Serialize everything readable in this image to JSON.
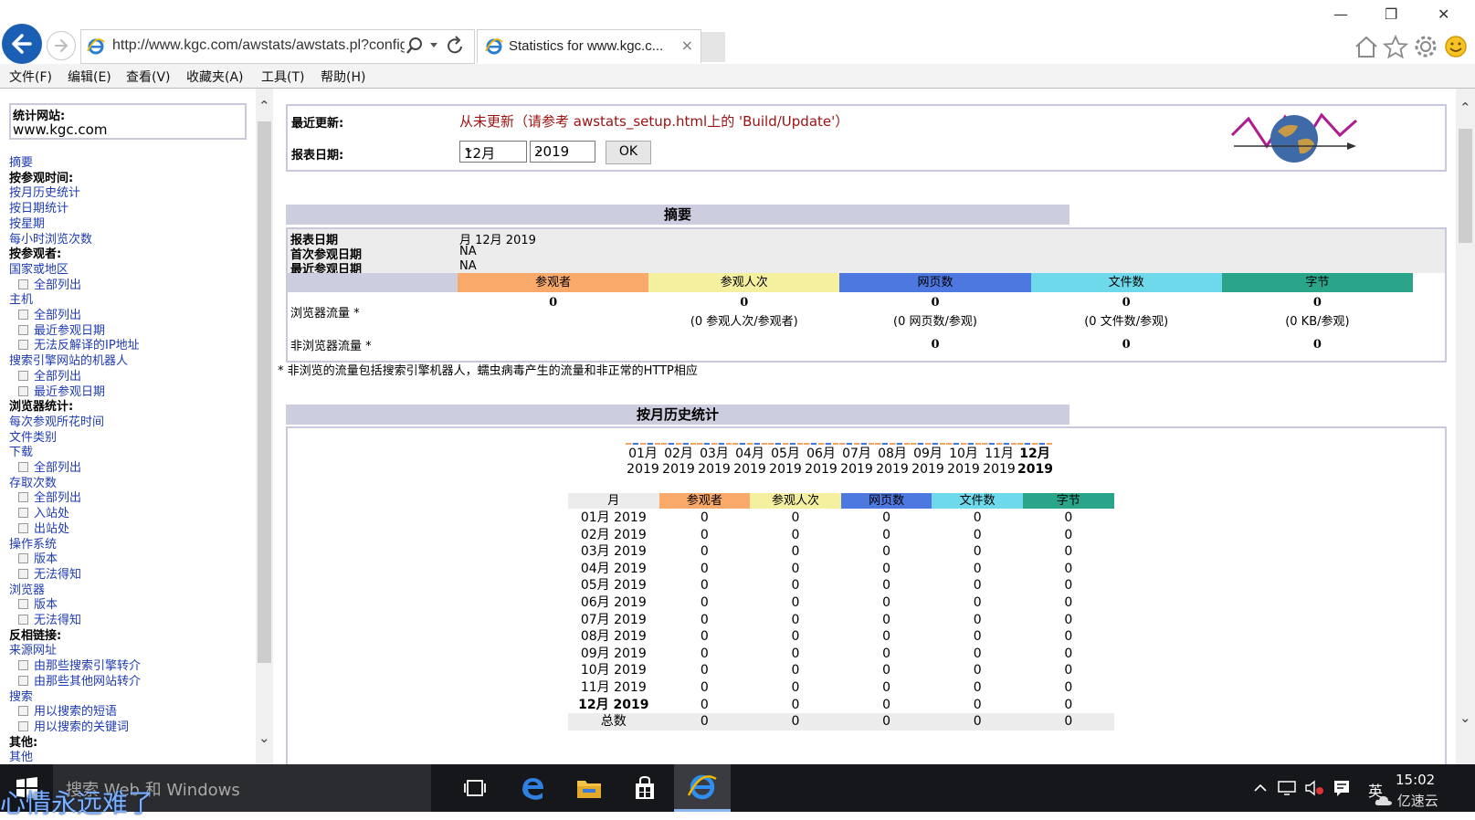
{
  "browser": {
    "url": "http://www.kgc.com/awstats/awstats.pl?config=www.kgc.com",
    "tab_title": "Statistics for www.kgc.c...",
    "tab_close": "×",
    "menu": [
      "文件(F)",
      "编辑(E)",
      "查看(V)",
      "收藏夹(A)",
      "工具(T)",
      "帮助(H)"
    ]
  },
  "sidebar": {
    "site_label": "统计网站:",
    "site_value": "www.kgc.com",
    "items": [
      {
        "text": "摘要",
        "kind": "link"
      },
      {
        "text": "按参观时间:",
        "kind": "heading"
      },
      {
        "text": "按月历史统计",
        "kind": "link"
      },
      {
        "text": "按日期统计",
        "kind": "link"
      },
      {
        "text": "按星期",
        "kind": "link"
      },
      {
        "text": "每小时浏览次数",
        "kind": "link"
      },
      {
        "text": "按参观者:",
        "kind": "heading"
      },
      {
        "text": "国家或地区",
        "kind": "link"
      },
      {
        "text": "全部列出",
        "kind": "sub"
      },
      {
        "text": "主机",
        "kind": "link"
      },
      {
        "text": "全部列出",
        "kind": "sub"
      },
      {
        "text": "最近参观日期",
        "kind": "sub"
      },
      {
        "text": "无法反解译的IP地址",
        "kind": "sub"
      },
      {
        "text": "搜索引擎网站的机器人",
        "kind": "link"
      },
      {
        "text": "全部列出",
        "kind": "sub"
      },
      {
        "text": "最近参观日期",
        "kind": "sub"
      },
      {
        "text": "浏览器统计:",
        "kind": "heading"
      },
      {
        "text": "每次参观所花时间",
        "kind": "link"
      },
      {
        "text": "文件类别",
        "kind": "link"
      },
      {
        "text": "下载",
        "kind": "link"
      },
      {
        "text": "全部列出",
        "kind": "sub"
      },
      {
        "text": "存取次数",
        "kind": "link"
      },
      {
        "text": "全部列出",
        "kind": "sub"
      },
      {
        "text": "入站处",
        "kind": "sub"
      },
      {
        "text": "出站处",
        "kind": "sub"
      },
      {
        "text": "操作系统",
        "kind": "link"
      },
      {
        "text": "版本",
        "kind": "sub"
      },
      {
        "text": "无法得知",
        "kind": "sub"
      },
      {
        "text": "浏览器",
        "kind": "link"
      },
      {
        "text": "版本",
        "kind": "sub"
      },
      {
        "text": "无法得知",
        "kind": "sub"
      },
      {
        "text": "反相链接:",
        "kind": "heading"
      },
      {
        "text": "来源网址",
        "kind": "link"
      },
      {
        "text": "由那些搜索引擎转介",
        "kind": "sub"
      },
      {
        "text": "由那些其他网站转介",
        "kind": "sub"
      },
      {
        "text": "搜索",
        "kind": "link"
      },
      {
        "text": "用以搜索的短语",
        "kind": "sub"
      },
      {
        "text": "用以搜索的关键词",
        "kind": "sub"
      },
      {
        "text": "其他:",
        "kind": "heading"
      },
      {
        "text": "其他",
        "kind": "link"
      }
    ]
  },
  "update": {
    "last_update_label": "最近更新:",
    "last_update_value": "从未更新（请参考 awstats_setup.html上的 'Build/Update'）",
    "report_date_label": "报表日期:",
    "month_select": "12月",
    "year_select": "2019",
    "ok_label": "OK"
  },
  "summary": {
    "title": "摘要",
    "rows": [
      {
        "label": "报表日期",
        "value": "月 12月 2019"
      },
      {
        "label": "首次参观日期",
        "value": "NA"
      },
      {
        "label": "最近参观日期",
        "value": "NA"
      }
    ],
    "columns": [
      {
        "label": "参观者",
        "color": "#f9a96a"
      },
      {
        "label": "参观人次",
        "color": "#f4f0a0"
      },
      {
        "label": "网页数",
        "color": "#4d78e0"
      },
      {
        "label": "文件数",
        "color": "#6fd9ec"
      },
      {
        "label": "字节",
        "color": "#2aa58a"
      }
    ],
    "browser_label": "浏览器流量 *",
    "browser_values": [
      "0",
      "0",
      "0",
      "0",
      "0"
    ],
    "browser_sub": [
      "",
      "(0 参观人次/参观者)",
      "(0 网页数/参观)",
      "(0 文件数/参观)",
      "(0 KB/参观)"
    ],
    "nonbrowser_label": "非浏览器流量 *",
    "nonbrowser_values": [
      "0",
      "0",
      "0"
    ],
    "footnote": "* 非浏览的流量包括搜索引擎机器人，蠕虫病毒产生的流量和非正常的HTTP相应"
  },
  "monthly": {
    "title": "按月历史统计",
    "labels": [
      {
        "m": "01月",
        "y": "2019"
      },
      {
        "m": "02月",
        "y": "2019"
      },
      {
        "m": "03月",
        "y": "2019"
      },
      {
        "m": "04月",
        "y": "2019"
      },
      {
        "m": "05月",
        "y": "2019"
      },
      {
        "m": "06月",
        "y": "2019"
      },
      {
        "m": "07月",
        "y": "2019"
      },
      {
        "m": "08月",
        "y": "2019"
      },
      {
        "m": "09月",
        "y": "2019"
      },
      {
        "m": "10月",
        "y": "2019"
      },
      {
        "m": "11月",
        "y": "2019"
      },
      {
        "m": "12月",
        "y": "2019"
      }
    ],
    "headers": [
      "月",
      "参观者",
      "参观人次",
      "网页数",
      "文件数",
      "字节"
    ],
    "header_colors": [
      "#ececec",
      "#f9a96a",
      "#f4f0a0",
      "#4d78e0",
      "#6fd9ec",
      "#2aa58a"
    ],
    "rows": [
      [
        "01月 2019",
        "0",
        "0",
        "0",
        "0",
        "0"
      ],
      [
        "02月 2019",
        "0",
        "0",
        "0",
        "0",
        "0"
      ],
      [
        "03月 2019",
        "0",
        "0",
        "0",
        "0",
        "0"
      ],
      [
        "04月 2019",
        "0",
        "0",
        "0",
        "0",
        "0"
      ],
      [
        "05月 2019",
        "0",
        "0",
        "0",
        "0",
        "0"
      ],
      [
        "06月 2019",
        "0",
        "0",
        "0",
        "0",
        "0"
      ],
      [
        "07月 2019",
        "0",
        "0",
        "0",
        "0",
        "0"
      ],
      [
        "08月 2019",
        "0",
        "0",
        "0",
        "0",
        "0"
      ],
      [
        "09月 2019",
        "0",
        "0",
        "0",
        "0",
        "0"
      ],
      [
        "10月 2019",
        "0",
        "0",
        "0",
        "0",
        "0"
      ],
      [
        "11月 2019",
        "0",
        "0",
        "0",
        "0",
        "0"
      ],
      [
        "12月 2019",
        "0",
        "0",
        "0",
        "0",
        "0"
      ]
    ],
    "total": [
      "总数",
      "0",
      "0",
      "0",
      "0",
      "0"
    ]
  },
  "taskbar": {
    "search_placeholder": "搜索 Web 和 Windows",
    "time": "15:02",
    "ime": "英",
    "overlay_text": "心情永远难了",
    "watermark": "亿速云"
  }
}
